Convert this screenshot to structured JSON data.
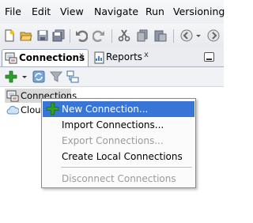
{
  "menubar": {
    "items": [
      {
        "label": "File"
      },
      {
        "label": "Edit"
      },
      {
        "label": "View"
      },
      {
        "label": "Navigate"
      },
      {
        "label": "Run"
      },
      {
        "label": "Versioning"
      }
    ]
  },
  "toolbar": {
    "icons": [
      "new-icon",
      "open-folder-icon",
      "save-icon",
      "save-all-icon",
      "undo-icon",
      "redo-icon",
      "cut-icon",
      "copy-icon",
      "paste-icon",
      "back-icon",
      "dropdown-arrow-icon",
      "forward-icon"
    ]
  },
  "tabs": [
    {
      "label": "Connections",
      "close": "x",
      "active": true
    },
    {
      "label": "Reports",
      "close": "x",
      "active": false
    }
  ],
  "tree": {
    "items": [
      {
        "label": "Connections",
        "icon": "connections-icon"
      },
      {
        "label": "Cloud",
        "icon": "cloud-icon"
      }
    ]
  },
  "context_menu": {
    "items": [
      {
        "label": "New Connection...",
        "enabled": true,
        "selected": true,
        "icon": "green-plus-icon"
      },
      {
        "label": "Import Connections...",
        "enabled": true
      },
      {
        "label": "Export Connections...",
        "enabled": false
      },
      {
        "label": "Create Local Connections",
        "enabled": true
      },
      {
        "label": "Disconnect Connections",
        "enabled": false
      }
    ]
  },
  "colors": {
    "selection": "#3875d7",
    "add_green": "#2e9e2e",
    "disabled_text": "#9a9a9a"
  }
}
